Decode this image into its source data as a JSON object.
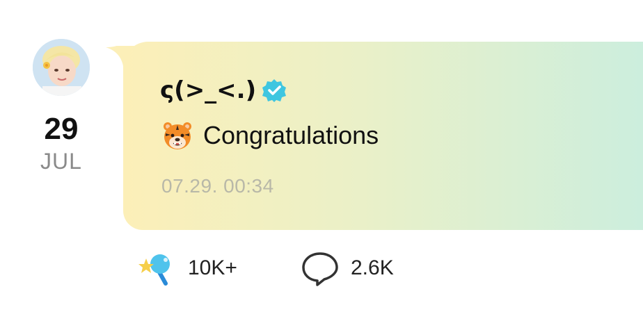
{
  "post": {
    "date_day": "29",
    "date_month": "JUL",
    "author_name": "ς(>_<.)",
    "message": "Congratulations",
    "timestamp": "07.29. 00:34"
  },
  "reactions": {
    "likes_count": "10K+",
    "comments_count": "2.6K"
  },
  "icons": {
    "verified": "verified-badge-icon",
    "tiger": "tiger-emoji-icon",
    "like": "star-wand-like-icon",
    "comment": "speech-bubble-icon"
  },
  "colors": {
    "bubble_start": "#fcefb8",
    "bubble_end": "#cbeede",
    "verified": "#3fc6e0",
    "timestamp": "#b8b8a8"
  }
}
